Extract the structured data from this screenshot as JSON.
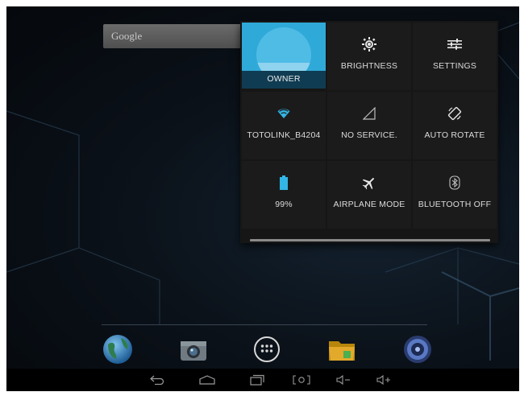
{
  "search_widget": {
    "label": "Google"
  },
  "quick_settings": {
    "tiles": [
      {
        "id": "owner",
        "label": "OWNER",
        "icon": "user-avatar-icon",
        "active": true
      },
      {
        "id": "brightness",
        "label": "BRIGHTNESS",
        "icon": "brightness-icon"
      },
      {
        "id": "settings",
        "label": "SETTINGS",
        "icon": "settings-sliders-icon"
      },
      {
        "id": "wifi",
        "label": "TOTOLINK_B4204",
        "icon": "wifi-icon"
      },
      {
        "id": "signal",
        "label": "NO SERVICE.",
        "icon": "signal-icon"
      },
      {
        "id": "rotate",
        "label": "AUTO ROTATE",
        "icon": "auto-rotate-icon"
      },
      {
        "id": "battery",
        "label": "99%",
        "icon": "battery-icon",
        "level": 0.99
      },
      {
        "id": "airplane",
        "label": "AIRPLANE MODE",
        "icon": "airplane-icon"
      },
      {
        "id": "bluetooth",
        "label": "BLUETOOTH OFF",
        "icon": "bluetooth-icon"
      }
    ]
  },
  "dock": {
    "icons": [
      "browser-globe-icon",
      "camera-icon",
      "app-drawer-icon",
      "file-manager-folder-icon",
      "music-speaker-icon"
    ]
  },
  "nav_bar": {
    "buttons": [
      "back-icon",
      "home-icon",
      "recent-apps-icon",
      "screenshot-icon",
      "volume-down-icon",
      "volume-up-icon"
    ]
  },
  "colors": {
    "accent_blue": "#2fa9d8",
    "wifi_blue": "#33b5e5",
    "panel_bg": "#161616",
    "tile_text": "#dcdcdc"
  }
}
